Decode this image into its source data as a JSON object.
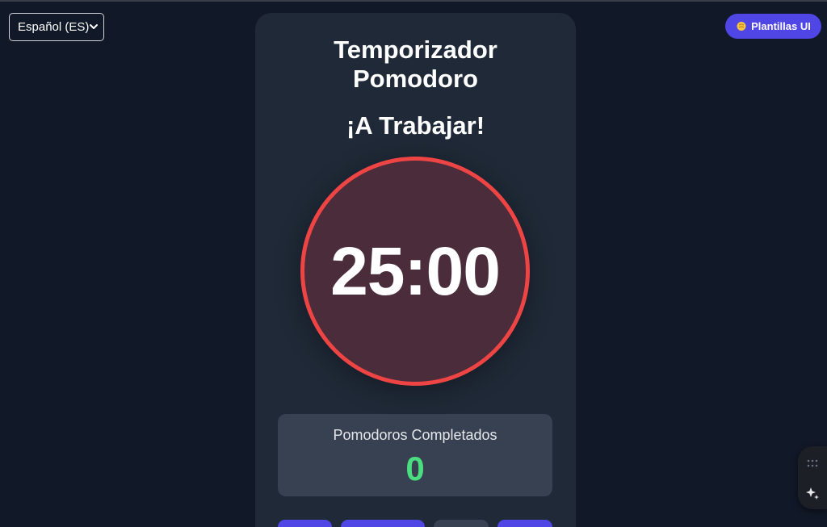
{
  "language_select": {
    "value": "Español (ES)"
  },
  "templates_button": {
    "label": "Plantillas UI"
  },
  "card": {
    "title_line1": "Temporizador",
    "title_line2": "Pomodoro",
    "mode_label": "¡A Trabajar!",
    "timer": "25:00",
    "stats_label": "Pomodoros Completados",
    "stats_value": "0"
  },
  "colors": {
    "background": "#111827",
    "card": "#1f2937",
    "accent": "#4f46e5",
    "timer_ring": "#ef4444",
    "stats_value": "#4ade80"
  }
}
